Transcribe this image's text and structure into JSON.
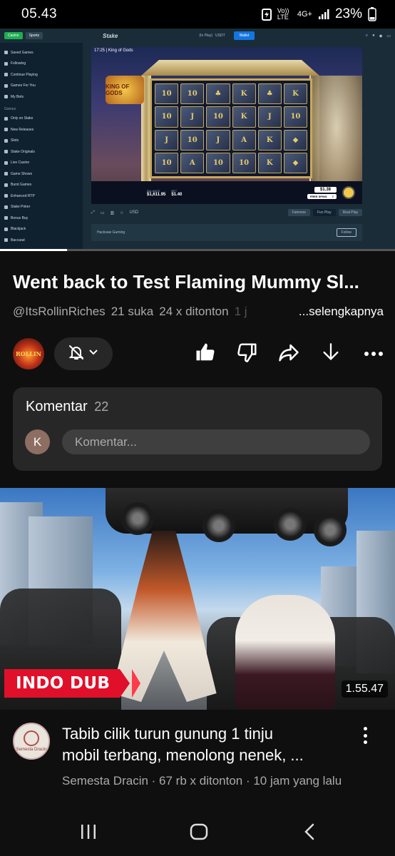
{
  "status_bar": {
    "time": "05.43",
    "network_volte": "Vo)) LTE",
    "network_type": "4G+",
    "battery": "23%"
  },
  "player": {
    "site_top": {
      "tab_casino": "Casino",
      "tab_sports": "Sports",
      "logo": "Stake",
      "play_mode": "(In Play)",
      "currency": "USDT",
      "wallet_label": "Wallet"
    },
    "sidebar": {
      "items_top": [
        "Saved Games",
        "Following",
        "Continue Playing",
        "Games For You",
        "My Bets"
      ],
      "games_header": "Games",
      "items_games": [
        "Only on Stake",
        "New Releases",
        "Slots",
        "Stake Originals",
        "Live Casino",
        "Game Shows",
        "Burst Games",
        "Enhanced RTP",
        "Stake Poker",
        "Bonus Buy",
        "Blackjack",
        "Baccarat"
      ]
    },
    "game": {
      "title": "17:25 | King of Gods",
      "logo_text": "KING OF GODS",
      "reel_symbols": [
        "10",
        "10",
        "♣",
        "K",
        "♣",
        "K",
        "10",
        "J",
        "10",
        "K",
        "J",
        "10",
        "J",
        "10",
        "J",
        "A",
        "K",
        "◆",
        "10",
        "A",
        "10",
        "10",
        "K",
        "◆"
      ],
      "balance_label": "BALANCE",
      "balance_value": "$1,611.95",
      "bet_label": "BET",
      "bet_value": "$1.40",
      "win_amount": "$1.38",
      "free_spins_label": "FREE SPINS",
      "free_spins_count": "7"
    },
    "controls": {
      "currency": "USD",
      "fairness": "Fairness",
      "fun_play": "Fun Play",
      "real_play": "Real Play",
      "provider": "Hacksaw Gaming",
      "follow": "Follow"
    },
    "progress_fraction": 0.17
  },
  "video": {
    "title": "Went back to Test Flaming Mummy Sl...",
    "channel_handle": "@ItsRollinRiches",
    "likes": "21 suka",
    "views": "24 x ditonton",
    "time_partial": "1 j",
    "more": "...selengkapnya",
    "channel_avatar_text": "ROLLIN"
  },
  "comments": {
    "label": "Komentar",
    "count": "22",
    "avatar_letter": "K",
    "placeholder": "Komentar..."
  },
  "next_video": {
    "badge": "INDO DUB",
    "duration": "1.55.47",
    "title_line1": "Tabib cilik turun gunung 1 tinju",
    "title_line2": "mobil terbang, menolong nenek, ...",
    "channel": "Semesta Dracin",
    "meta": "67 rb x ditonton · 10 jam yang lalu",
    "avatar_text": "Semesta Dracin"
  },
  "icons": {
    "like": "thumbs-up-icon",
    "dislike": "thumbs-down-icon",
    "share": "share-icon",
    "download": "download-icon",
    "more": "more-horizontal-icon",
    "bell": "bell-off-icon"
  }
}
